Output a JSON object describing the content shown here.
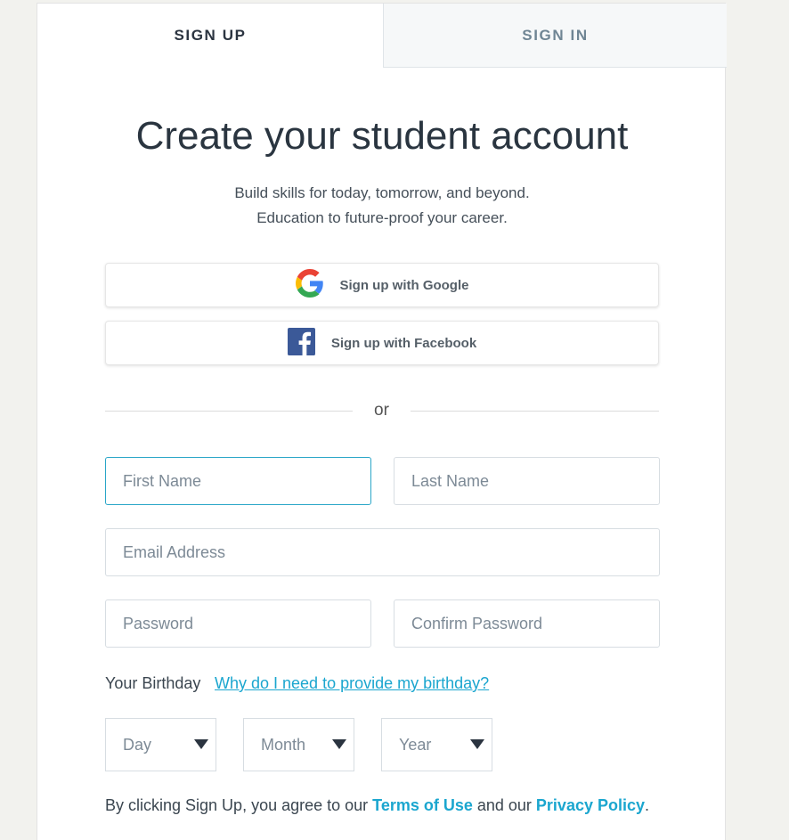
{
  "tabs": {
    "signup": "SIGN UP",
    "signin": "SIGN IN"
  },
  "heading": "Create your student account",
  "subtitle": {
    "line1": "Build skills for today, tomorrow, and beyond.",
    "line2": "Education to future-proof your career."
  },
  "social": {
    "google_label": "Sign up with Google",
    "facebook_label": "Sign up with Facebook"
  },
  "divider_text": "or",
  "form": {
    "first_name_placeholder": "First Name",
    "last_name_placeholder": "Last Name",
    "email_placeholder": "Email Address",
    "password_placeholder": "Password",
    "confirm_password_placeholder": "Confirm Password"
  },
  "birthday": {
    "label": "Your Birthday",
    "help_link": "Why do I need to provide my birthday?",
    "day": "Day",
    "month": "Month",
    "year": "Year"
  },
  "terms": {
    "prefix": "By clicking Sign Up, you agree to our ",
    "terms_link": "Terms of Use",
    "middle": " and our ",
    "privacy_link": "Privacy Policy",
    "suffix": "."
  },
  "colors": {
    "accent": "#1ba6cf",
    "focus_border": "#2aa6c8",
    "facebook_blue": "#3b5998"
  },
  "icons": {
    "google": "google-logo-icon",
    "facebook": "facebook-logo-icon",
    "dropdown": "caret-down-icon"
  }
}
